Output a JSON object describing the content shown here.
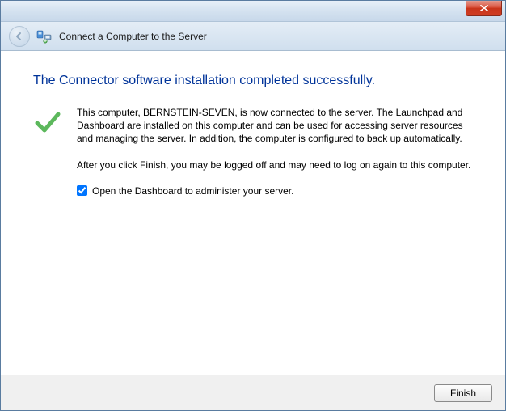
{
  "header": {
    "title": "Connect a Computer to the Server"
  },
  "main": {
    "heading": "The Connector software installation completed successfully.",
    "paragraph1": "This computer, BERNSTEIN-SEVEN, is now connected to the server. The Launchpad and Dashboard are installed on this computer and can be used for accessing server resources and managing the server. In addition, the computer is configured to back up automatically.",
    "paragraph2": "After you click Finish, you may be logged off and may need to log on again to this computer.",
    "checkbox_label": "Open the Dashboard to administer your server.",
    "checkbox_checked": true
  },
  "footer": {
    "finish_label": "Finish"
  }
}
